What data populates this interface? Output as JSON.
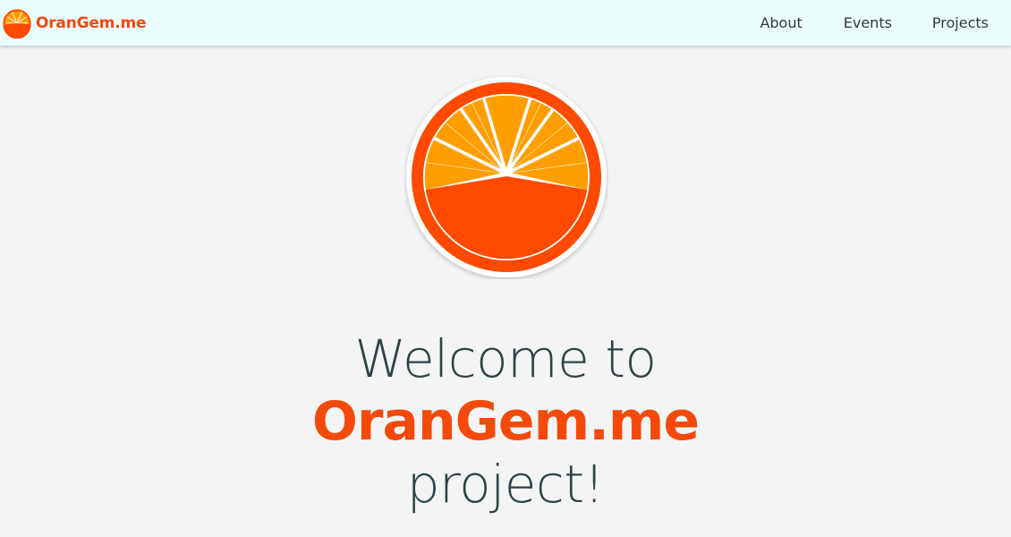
{
  "navbar": {
    "brand_text": "OranGem.me",
    "links": [
      {
        "label": "About"
      },
      {
        "label": "Events"
      },
      {
        "label": "Projects"
      }
    ]
  },
  "hero": {
    "logo_icon": "orange-slice-icon",
    "headline_line1": "Welcome to",
    "headline_line2": "OranGem.me",
    "headline_line3": "project!"
  },
  "colors": {
    "brand_orange": "#f34a0b",
    "slice_orange": "#ff9e00",
    "navbar_bg": "#ebfcfd",
    "page_bg": "#f4f4f4",
    "text_dark": "#2c4346"
  }
}
